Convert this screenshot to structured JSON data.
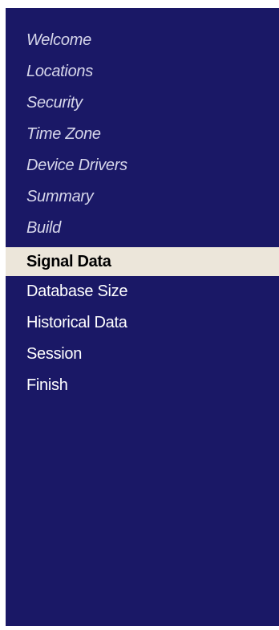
{
  "wizard_nav": {
    "steps": [
      {
        "label": "Welcome",
        "state": "completed"
      },
      {
        "label": "Locations",
        "state": "completed"
      },
      {
        "label": "Security",
        "state": "completed"
      },
      {
        "label": "Time Zone",
        "state": "completed"
      },
      {
        "label": "Device Drivers",
        "state": "completed"
      },
      {
        "label": "Summary",
        "state": "completed"
      },
      {
        "label": "Build",
        "state": "completed"
      },
      {
        "label": "Signal Data",
        "state": "current"
      },
      {
        "label": "Database Size",
        "state": "pending"
      },
      {
        "label": "Historical Data",
        "state": "pending"
      },
      {
        "label": "Session",
        "state": "pending"
      },
      {
        "label": "Finish",
        "state": "pending"
      }
    ],
    "colors": {
      "panel_background": "#1a1866",
      "current_highlight": "#ece6da",
      "completed_text": "#d6d6ea",
      "pending_text": "#ffffff",
      "current_text": "#000000"
    }
  }
}
